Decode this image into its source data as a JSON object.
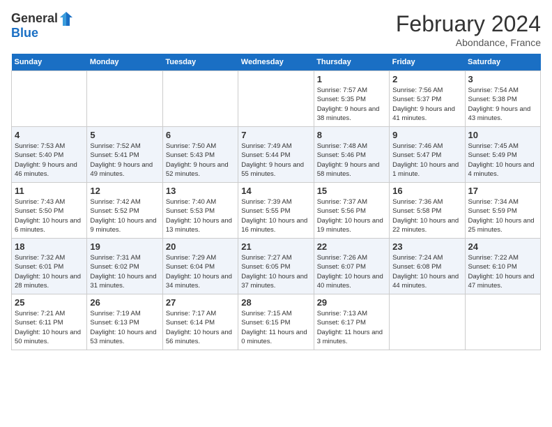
{
  "header": {
    "logo_line1": "General",
    "logo_line2": "Blue",
    "month_title": "February 2024",
    "location": "Abondance, France"
  },
  "days_of_week": [
    "Sunday",
    "Monday",
    "Tuesday",
    "Wednesday",
    "Thursday",
    "Friday",
    "Saturday"
  ],
  "weeks": [
    [
      {
        "day": "",
        "sunrise": "",
        "sunset": "",
        "daylight": ""
      },
      {
        "day": "",
        "sunrise": "",
        "sunset": "",
        "daylight": ""
      },
      {
        "day": "",
        "sunrise": "",
        "sunset": "",
        "daylight": ""
      },
      {
        "day": "",
        "sunrise": "",
        "sunset": "",
        "daylight": ""
      },
      {
        "day": "1",
        "sunrise": "Sunrise: 7:57 AM",
        "sunset": "Sunset: 5:35 PM",
        "daylight": "Daylight: 9 hours and 38 minutes."
      },
      {
        "day": "2",
        "sunrise": "Sunrise: 7:56 AM",
        "sunset": "Sunset: 5:37 PM",
        "daylight": "Daylight: 9 hours and 41 minutes."
      },
      {
        "day": "3",
        "sunrise": "Sunrise: 7:54 AM",
        "sunset": "Sunset: 5:38 PM",
        "daylight": "Daylight: 9 hours and 43 minutes."
      }
    ],
    [
      {
        "day": "4",
        "sunrise": "Sunrise: 7:53 AM",
        "sunset": "Sunset: 5:40 PM",
        "daylight": "Daylight: 9 hours and 46 minutes."
      },
      {
        "day": "5",
        "sunrise": "Sunrise: 7:52 AM",
        "sunset": "Sunset: 5:41 PM",
        "daylight": "Daylight: 9 hours and 49 minutes."
      },
      {
        "day": "6",
        "sunrise": "Sunrise: 7:50 AM",
        "sunset": "Sunset: 5:43 PM",
        "daylight": "Daylight: 9 hours and 52 minutes."
      },
      {
        "day": "7",
        "sunrise": "Sunrise: 7:49 AM",
        "sunset": "Sunset: 5:44 PM",
        "daylight": "Daylight: 9 hours and 55 minutes."
      },
      {
        "day": "8",
        "sunrise": "Sunrise: 7:48 AM",
        "sunset": "Sunset: 5:46 PM",
        "daylight": "Daylight: 9 hours and 58 minutes."
      },
      {
        "day": "9",
        "sunrise": "Sunrise: 7:46 AM",
        "sunset": "Sunset: 5:47 PM",
        "daylight": "Daylight: 10 hours and 1 minute."
      },
      {
        "day": "10",
        "sunrise": "Sunrise: 7:45 AM",
        "sunset": "Sunset: 5:49 PM",
        "daylight": "Daylight: 10 hours and 4 minutes."
      }
    ],
    [
      {
        "day": "11",
        "sunrise": "Sunrise: 7:43 AM",
        "sunset": "Sunset: 5:50 PM",
        "daylight": "Daylight: 10 hours and 6 minutes."
      },
      {
        "day": "12",
        "sunrise": "Sunrise: 7:42 AM",
        "sunset": "Sunset: 5:52 PM",
        "daylight": "Daylight: 10 hours and 9 minutes."
      },
      {
        "day": "13",
        "sunrise": "Sunrise: 7:40 AM",
        "sunset": "Sunset: 5:53 PM",
        "daylight": "Daylight: 10 hours and 13 minutes."
      },
      {
        "day": "14",
        "sunrise": "Sunrise: 7:39 AM",
        "sunset": "Sunset: 5:55 PM",
        "daylight": "Daylight: 10 hours and 16 minutes."
      },
      {
        "day": "15",
        "sunrise": "Sunrise: 7:37 AM",
        "sunset": "Sunset: 5:56 PM",
        "daylight": "Daylight: 10 hours and 19 minutes."
      },
      {
        "day": "16",
        "sunrise": "Sunrise: 7:36 AM",
        "sunset": "Sunset: 5:58 PM",
        "daylight": "Daylight: 10 hours and 22 minutes."
      },
      {
        "day": "17",
        "sunrise": "Sunrise: 7:34 AM",
        "sunset": "Sunset: 5:59 PM",
        "daylight": "Daylight: 10 hours and 25 minutes."
      }
    ],
    [
      {
        "day": "18",
        "sunrise": "Sunrise: 7:32 AM",
        "sunset": "Sunset: 6:01 PM",
        "daylight": "Daylight: 10 hours and 28 minutes."
      },
      {
        "day": "19",
        "sunrise": "Sunrise: 7:31 AM",
        "sunset": "Sunset: 6:02 PM",
        "daylight": "Daylight: 10 hours and 31 minutes."
      },
      {
        "day": "20",
        "sunrise": "Sunrise: 7:29 AM",
        "sunset": "Sunset: 6:04 PM",
        "daylight": "Daylight: 10 hours and 34 minutes."
      },
      {
        "day": "21",
        "sunrise": "Sunrise: 7:27 AM",
        "sunset": "Sunset: 6:05 PM",
        "daylight": "Daylight: 10 hours and 37 minutes."
      },
      {
        "day": "22",
        "sunrise": "Sunrise: 7:26 AM",
        "sunset": "Sunset: 6:07 PM",
        "daylight": "Daylight: 10 hours and 40 minutes."
      },
      {
        "day": "23",
        "sunrise": "Sunrise: 7:24 AM",
        "sunset": "Sunset: 6:08 PM",
        "daylight": "Daylight: 10 hours and 44 minutes."
      },
      {
        "day": "24",
        "sunrise": "Sunrise: 7:22 AM",
        "sunset": "Sunset: 6:10 PM",
        "daylight": "Daylight: 10 hours and 47 minutes."
      }
    ],
    [
      {
        "day": "25",
        "sunrise": "Sunrise: 7:21 AM",
        "sunset": "Sunset: 6:11 PM",
        "daylight": "Daylight: 10 hours and 50 minutes."
      },
      {
        "day": "26",
        "sunrise": "Sunrise: 7:19 AM",
        "sunset": "Sunset: 6:13 PM",
        "daylight": "Daylight: 10 hours and 53 minutes."
      },
      {
        "day": "27",
        "sunrise": "Sunrise: 7:17 AM",
        "sunset": "Sunset: 6:14 PM",
        "daylight": "Daylight: 10 hours and 56 minutes."
      },
      {
        "day": "28",
        "sunrise": "Sunrise: 7:15 AM",
        "sunset": "Sunset: 6:15 PM",
        "daylight": "Daylight: 11 hours and 0 minutes."
      },
      {
        "day": "29",
        "sunrise": "Sunrise: 7:13 AM",
        "sunset": "Sunset: 6:17 PM",
        "daylight": "Daylight: 11 hours and 3 minutes."
      },
      {
        "day": "",
        "sunrise": "",
        "sunset": "",
        "daylight": ""
      },
      {
        "day": "",
        "sunrise": "",
        "sunset": "",
        "daylight": ""
      }
    ]
  ]
}
